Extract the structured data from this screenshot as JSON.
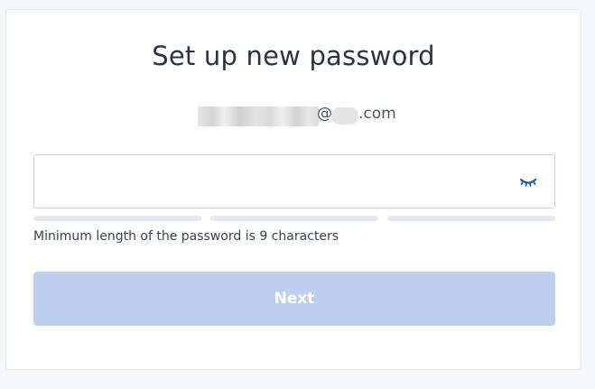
{
  "page": {
    "title": "Set up new password"
  },
  "email": {
    "at_sign": "@",
    "tld": ".com"
  },
  "password_field": {
    "value": "",
    "placeholder": "",
    "toggle_icon": "eye-closed-icon"
  },
  "strength_meter": {
    "segments": 3,
    "filled": 0
  },
  "hint": {
    "text": "Minimum length of the password is 9 characters"
  },
  "actions": {
    "next_label": "Next",
    "next_enabled": false
  },
  "colors": {
    "accent": "#1f5fa8",
    "button_disabled": "#bcd0ed",
    "bar_empty": "#e4e9f1"
  }
}
